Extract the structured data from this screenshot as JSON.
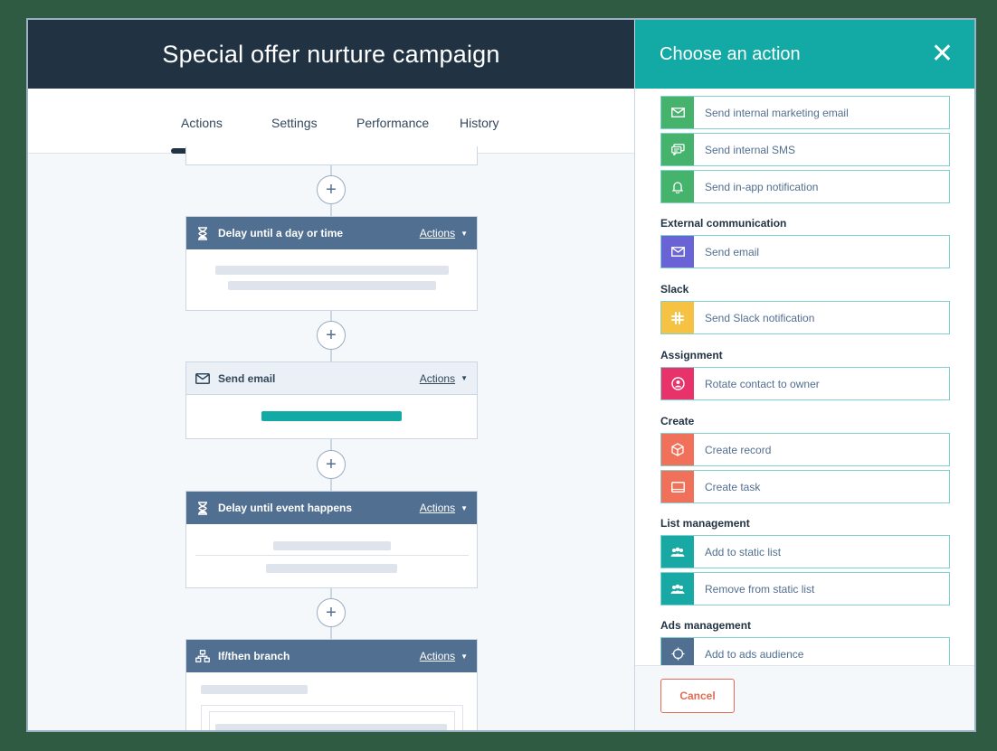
{
  "app": {
    "title": "Special offer nurture campaign",
    "tabs": [
      {
        "label": "Actions",
        "active": true
      },
      {
        "label": "Settings",
        "active": false
      },
      {
        "label": "Performance",
        "active": false
      },
      {
        "label": "History",
        "active": false
      }
    ]
  },
  "workflow": {
    "actions_label": "Actions",
    "cards": [
      {
        "title": "Delay until a day or time",
        "icon": "hourglass-icon",
        "style": "dark"
      },
      {
        "title": "Send email",
        "icon": "envelope-icon",
        "style": "light"
      },
      {
        "title": "Delay until event happens",
        "icon": "hourglass-icon",
        "style": "dark"
      },
      {
        "title": "If/then branch",
        "icon": "branch-icon",
        "style": "dark"
      }
    ]
  },
  "panel": {
    "title": "Choose an action",
    "items_top": [
      {
        "label": "Send internal marketing email",
        "icon": "envelope-icon",
        "color": "#45b36b"
      },
      {
        "label": "Send internal SMS",
        "icon": "chat-icon",
        "color": "#45b36b"
      },
      {
        "label": "Send in-app notification",
        "icon": "bell-icon",
        "color": "#45b36b"
      }
    ],
    "sections": [
      {
        "heading": "External communication",
        "items": [
          {
            "label": "Send email",
            "icon": "envelope-icon",
            "color": "#6a63d5"
          }
        ]
      },
      {
        "heading": "Slack",
        "items": [
          {
            "label": "Send Slack notification",
            "icon": "slack-icon",
            "color": "#f5c243"
          }
        ]
      },
      {
        "heading": "Assignment",
        "items": [
          {
            "label": "Rotate contact to owner",
            "icon": "owner-icon",
            "color": "#e8336a"
          }
        ]
      },
      {
        "heading": "Create",
        "items": [
          {
            "label": "Create record",
            "icon": "cube-icon",
            "color": "#f0705a"
          },
          {
            "label": "Create task",
            "icon": "task-icon",
            "color": "#f0705a"
          }
        ]
      },
      {
        "heading": "List management",
        "items": [
          {
            "label": "Add to static list",
            "icon": "people-icon",
            "color": "#19a9a5"
          },
          {
            "label": "Remove from static list",
            "icon": "people-icon",
            "color": "#19a9a5"
          }
        ]
      },
      {
        "heading": "Ads management",
        "items": [
          {
            "label": "Add to ads audience",
            "icon": "target-icon",
            "color": "#516f90"
          }
        ]
      }
    ],
    "cancel_label": "Cancel"
  },
  "colors": {
    "header_dark": "#213343",
    "panel_teal": "#13aaa5",
    "card_header": "#516f90",
    "email_bar": "#13aaa5",
    "cancel": "#e26b54"
  }
}
